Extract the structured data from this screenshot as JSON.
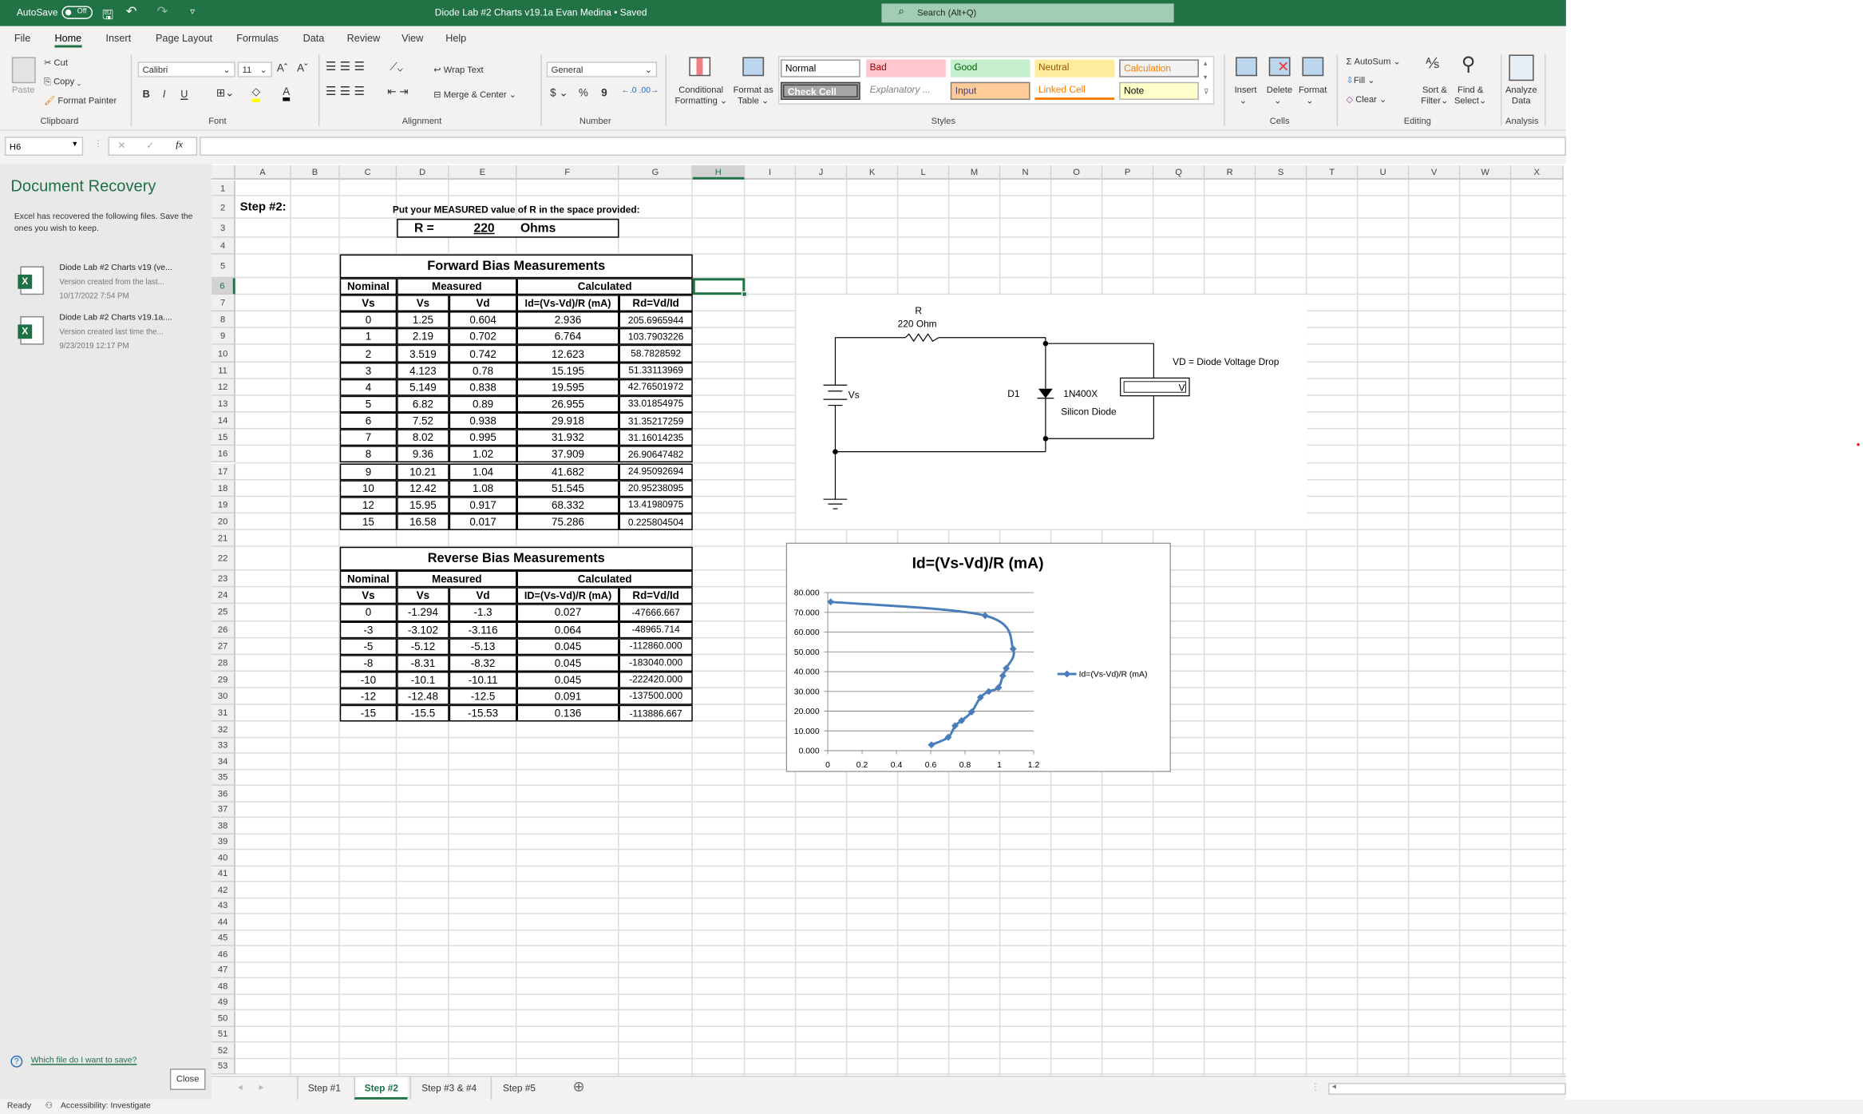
{
  "titlebar": {
    "autosave_label": "AutoSave",
    "autosave_state": "Off",
    "title": "Diode Lab #2 Charts v19.1a Evan Medina • Saved",
    "search_placeholder": "Search (Alt+Q)"
  },
  "menu_tabs": [
    "File",
    "Home",
    "Insert",
    "Page Layout",
    "Formulas",
    "Data",
    "Review",
    "View",
    "Help"
  ],
  "active_tab": "Home",
  "ribbon": {
    "clipboard": {
      "paste": "Paste",
      "cut": "Cut",
      "copy": "Copy",
      "format_painter": "Format Painter",
      "label": "Clipboard"
    },
    "font": {
      "name": "Calibri",
      "size": "11",
      "bold": "B",
      "italic": "I",
      "underline": "U",
      "label": "Font",
      "fill_color": "#ffff00",
      "font_color": "#000000"
    },
    "alignment": {
      "wrap_text": "Wrap Text",
      "merge_center": "Merge & Center",
      "label": "Alignment"
    },
    "number": {
      "format": "General",
      "currency": "$",
      "percent": "%",
      "comma": "9",
      "label": "Number"
    },
    "conditional_formatting": [
      "Conditional",
      "Formatting"
    ],
    "format_as_table": [
      "Format as",
      "Table"
    ],
    "styles": {
      "label": "Styles",
      "items": [
        {
          "name": "Normal",
          "bg": "#ffffff",
          "fg": "#000000"
        },
        {
          "name": "Bad",
          "bg": "#ffc7ce",
          "fg": "#9c0006"
        },
        {
          "name": "Good",
          "bg": "#c6efce",
          "fg": "#006100"
        },
        {
          "name": "Neutral",
          "bg": "#ffeb9c",
          "fg": "#9c5700"
        },
        {
          "name": "Calculation",
          "bg": "#f2f2f2",
          "fg": "#fa7d00"
        },
        {
          "name": "Check Cell",
          "bg": "#a5a5a5",
          "fg": "#ffffff"
        },
        {
          "name": "Explanatory ...",
          "bg": "#ffffff",
          "fg": "#7f7f7f"
        },
        {
          "name": "Input",
          "bg": "#ffcc99",
          "fg": "#3f3f76"
        },
        {
          "name": "Linked Cell",
          "bg": "#ffffff",
          "fg": "#fa7d00"
        },
        {
          "name": "Note",
          "bg": "#ffffcc",
          "fg": "#000000"
        }
      ]
    },
    "cells": {
      "insert": "Insert",
      "delete": "Delete",
      "format": "Format",
      "label": "Cells"
    },
    "editing": {
      "autosum": "AutoSum",
      "fill": "Fill",
      "clear": "Clear",
      "sort": [
        "Sort &",
        "Filter"
      ],
      "find": [
        "Find &",
        "Select"
      ],
      "label": "Editing"
    },
    "analysis": {
      "analyze": [
        "Analyze",
        "Data"
      ],
      "label": "Analysis"
    }
  },
  "formula_bar": {
    "name_box": "H6",
    "formula": ""
  },
  "recovery": {
    "title": "Document Recovery",
    "description": "Excel has recovered the following files.  Save the ones you wish to keep.",
    "files": [
      {
        "name": "Diode Lab #2 Charts v19 (ve...",
        "desc": "Version created from the last...",
        "date": "10/17/2022 7:54 PM"
      },
      {
        "name": "Diode Lab #2 Charts v19.1a....",
        "desc": "Version created last time the...",
        "date": "9/23/2019 12:17 PM"
      }
    ],
    "help_link": "Which file do I want to save?",
    "close": "Close"
  },
  "columns": [
    "A",
    "B",
    "C",
    "D",
    "E",
    "F",
    "G",
    "H",
    "I",
    "J",
    "K",
    "L",
    "M",
    "N",
    "O",
    "P",
    "Q",
    "R",
    "S",
    "T",
    "U",
    "V",
    "W",
    "X"
  ],
  "rows": [
    "1",
    "2",
    "3",
    "4",
    "5",
    "6",
    "7",
    "8",
    "9",
    "10",
    "11",
    "12",
    "13",
    "14",
    "15",
    "16",
    "17",
    "18",
    "19",
    "20",
    "21",
    "22",
    "23",
    "24",
    "25",
    "26",
    "27",
    "28",
    "29",
    "30",
    "31",
    "32",
    "33",
    "34",
    "35",
    "36",
    "37",
    "38",
    "39",
    "40",
    "41",
    "42",
    "43",
    "44",
    "45",
    "46",
    "47",
    "48",
    "49",
    "50",
    "51",
    "52",
    "53"
  ],
  "selected_cell": "H6",
  "sheet": {
    "step_label": "Step #2:",
    "instruction": "Put your MEASURED value of R in the space provided:",
    "r_box": {
      "label": "R  =",
      "value": "220",
      "unit": "Ohms"
    },
    "forward": {
      "title": "Forward Bias Measurements",
      "groups": [
        "Nominal",
        "Measured",
        "Calculated"
      ],
      "headers": [
        "Vs",
        "Vs",
        "Vd",
        "Id=(Vs-Vd)/R (mA)",
        "Rd=Vd/Id"
      ],
      "rows": [
        [
          "0",
          "1.25",
          "0.604",
          "2.936",
          "205.6965944"
        ],
        [
          "1",
          "2.19",
          "0.702",
          "6.764",
          "103.7903226"
        ],
        [
          "2",
          "3.519",
          "0.742",
          "12.623",
          "58.7828592"
        ],
        [
          "3",
          "4.123",
          "0.78",
          "15.195",
          "51.33113969"
        ],
        [
          "4",
          "5.149",
          "0.838",
          "19.595",
          "42.76501972"
        ],
        [
          "5",
          "6.82",
          "0.89",
          "26.955",
          "33.01854975"
        ],
        [
          "6",
          "7.52",
          "0.938",
          "29.918",
          "31.35217259"
        ],
        [
          "7",
          "8.02",
          "0.995",
          "31.932",
          "31.16014235"
        ],
        [
          "8",
          "9.36",
          "1.02",
          "37.909",
          "26.90647482"
        ],
        [
          "9",
          "10.21",
          "1.04",
          "41.682",
          "24.95092694"
        ],
        [
          "10",
          "12.42",
          "1.08",
          "51.545",
          "20.95238095"
        ],
        [
          "12",
          "15.95",
          "0.917",
          "68.332",
          "13.41980975"
        ],
        [
          "15",
          "16.58",
          "0.017",
          "75.286",
          "0.225804504"
        ]
      ]
    },
    "reverse": {
      "title": "Reverse Bias Measurements",
      "groups": [
        "Nominal",
        "Measured",
        "Calculated"
      ],
      "headers": [
        "Vs",
        "Vs",
        "Vd",
        "ID=(Vs-Vd)/R (mA)",
        "Rd=Vd/Id"
      ],
      "rows": [
        [
          "0",
          "-1.294",
          "-1.3",
          "0.027",
          "-47666.667"
        ],
        [
          "-3",
          "-3.102",
          "-3.116",
          "0.064",
          "-48965.714"
        ],
        [
          "-5",
          "-5.12",
          "-5.13",
          "0.045",
          "-112860.000"
        ],
        [
          "-8",
          "-8.31",
          "-8.32",
          "0.045",
          "-183040.000"
        ],
        [
          "-10",
          "-10.1",
          "-10.11",
          "0.045",
          "-222420.000"
        ],
        [
          "-12",
          "-12.48",
          "-12.5",
          "0.091",
          "-137500.000"
        ],
        [
          "-15",
          "-15.5",
          "-15.53",
          "0.136",
          "-113886.667"
        ]
      ]
    }
  },
  "circuit": {
    "r_label": "R",
    "r_value": "220  Ohm",
    "source": "Vs",
    "diode_ref": "D1",
    "diode_part": "1N400X",
    "diode_desc": "Silicon Diode",
    "vd_note": "VD = Diode Voltage Drop",
    "meter": "V"
  },
  "chart_data": {
    "type": "scatter",
    "title": "Id=(Vs-Vd)/R (mA)",
    "smooth": true,
    "markers": "diamond",
    "color": "#4a7ebb",
    "series": [
      {
        "name": "Id=(Vs-Vd)/R (mA)",
        "x": [
          0.604,
          0.702,
          0.742,
          0.78,
          0.838,
          0.89,
          0.938,
          0.995,
          1.02,
          1.04,
          1.08,
          0.917,
          0.017
        ],
        "y": [
          2.936,
          6.764,
          12.623,
          15.195,
          19.595,
          26.955,
          29.918,
          31.932,
          37.909,
          41.682,
          51.545,
          68.332,
          75.286
        ]
      }
    ],
    "xlim": [
      0,
      1.2
    ],
    "ylim": [
      0,
      80
    ],
    "xticks": [
      "0",
      "0.2",
      "0.4",
      "0.6",
      "0.8",
      "1",
      "1.2"
    ],
    "yticks": [
      "0.000",
      "10.000",
      "20.000",
      "30.000",
      "40.000",
      "50.000",
      "60.000",
      "70.000",
      "80.000"
    ],
    "grid": "horizontal",
    "legend": "right"
  },
  "sheet_tabs": [
    "Step #1",
    "Step #2",
    "Step #3 & #4",
    "Step #5"
  ],
  "active_sheet": "Step #2",
  "status": {
    "ready": "Ready",
    "accessibility": "Accessibility: Investigate"
  }
}
